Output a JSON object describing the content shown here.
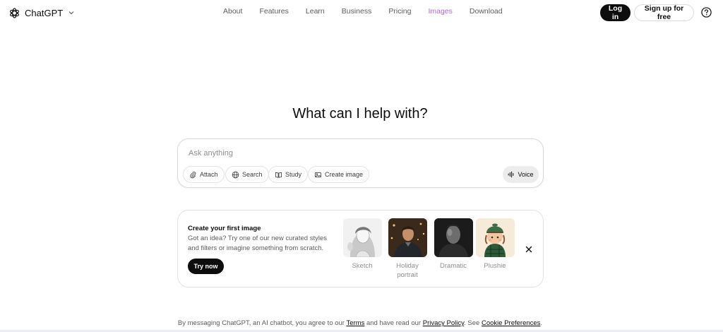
{
  "header": {
    "brand": "ChatGPT",
    "nav": [
      "About",
      "Features",
      "Learn",
      "Business",
      "Pricing",
      "Images",
      "Download"
    ],
    "active_nav": "Images",
    "login_label": "Log in",
    "signup_label": "Sign up for free"
  },
  "main": {
    "headline": "What can I help with?",
    "composer": {
      "placeholder": "Ask anything",
      "tools": [
        "Attach",
        "Search",
        "Study",
        "Create image"
      ],
      "voice_label": "Voice"
    }
  },
  "promo": {
    "title": "Create your first image",
    "description": "Got an idea? Try one of our new curated styles and filters or imagine something from scratch.",
    "try_label": "Try now",
    "styles": [
      "Sketch",
      "Holiday portrait",
      "Dramatic",
      "Plushie"
    ]
  },
  "footer": {
    "prefix": "By messaging ChatGPT, an AI chatbot, you agree to our",
    "terms": "Terms",
    "middle": "and have read our",
    "privacy": "Privacy Policy",
    "see": ". See",
    "cookie": "Cookie Preferences",
    "end": "."
  },
  "colors": {
    "accent_active_nav": "#b26bdc",
    "primary_button": "#0d0d0d"
  }
}
